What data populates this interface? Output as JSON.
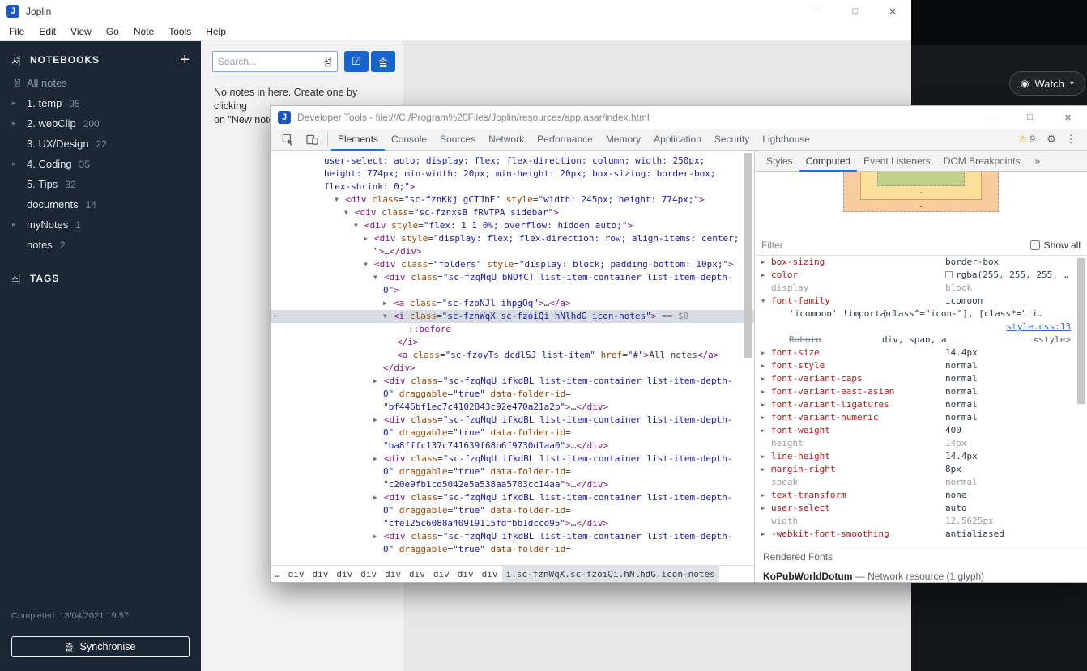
{
  "glyphs": {
    "arrow_right": "▸",
    "tree_expanded": "▼",
    "tree_collapsed": "▶",
    "minimize": "─",
    "maximize": "□",
    "close": "✕",
    "gear": "⚙",
    "kebab": "⋮",
    "warning": "⚠",
    "overflow_chevrons": "»",
    "dots": "⋯",
    "plus": "+",
    "caret_down": "▾"
  },
  "joplin": {
    "title": "Joplin",
    "app_letter": "J",
    "menu": [
      "File",
      "Edit",
      "View",
      "Go",
      "Note",
      "Tools",
      "Help"
    ],
    "sidebar": {
      "notebooks_label": "NOTEBOOKS",
      "notebooks_icon": "셔",
      "all_notes_icon": "셩",
      "all_notes_label": "All notes",
      "folders": [
        {
          "label": "1. temp",
          "count": "95",
          "arrow": true
        },
        {
          "label": "2. webClip",
          "count": "200",
          "arrow": true
        },
        {
          "label": "3. UX/Design",
          "count": "22",
          "arrow": false
        },
        {
          "label": "4. Coding",
          "count": "35",
          "arrow": true
        },
        {
          "label": "5. Tips",
          "count": "32",
          "arrow": false
        },
        {
          "label": "documents",
          "count": "14",
          "arrow": false
        },
        {
          "label": "myNotes",
          "count": "1",
          "arrow": true
        },
        {
          "label": "notes",
          "count": "2",
          "arrow": false
        }
      ],
      "tags_label": "TAGS",
      "tags_icon": "싀",
      "status": "Completed: 13/04/2021 19:57",
      "sync_label": "Synchronise",
      "sync_icon": "츨"
    },
    "notelist": {
      "search_placeholder": "Search...",
      "search_icon": "성",
      "toggle_button_icon": "☑",
      "sort_button_icon": "솔",
      "empty_lines": [
        "No notes in here. Create one by clicking",
        "on \"New note\"."
      ]
    }
  },
  "background": {
    "watch_label": "Watch",
    "watch_icon": "◉"
  },
  "devtools": {
    "title": "Developer Tools - file:///C:/Program%20Files/Joplin/resources/app.asar/index.html",
    "app_letter": "J",
    "toolbar": {
      "tabs": [
        {
          "label": "Elements",
          "active": true
        },
        {
          "label": "Console"
        },
        {
          "label": "Sources"
        },
        {
          "label": "Network"
        },
        {
          "label": "Performance"
        },
        {
          "label": "Memory"
        },
        {
          "label": "Application"
        },
        {
          "label": "Security"
        },
        {
          "label": "Lighthouse"
        }
      ],
      "warning_count": "9"
    },
    "elements": {
      "lines": [
        {
          "i": 58,
          "seg": [
            [
              "v",
              "user-select: auto; display: flex; flex-direction: column; width: 250px;"
            ]
          ]
        },
        {
          "i": 58,
          "seg": [
            [
              "v",
              "height: 774px; min-width: 20px; min-height: 20px; box-sizing: border-box;"
            ]
          ]
        },
        {
          "i": 58,
          "seg": [
            [
              "v",
              "flex-shrink: 0;\""
            ],
            [
              "t",
              ">"
            ]
          ]
        },
        {
          "i": 71,
          "a": "v",
          "seg": [
            [
              "t",
              "<div"
            ],
            [
              "a",
              " class"
            ],
            [
              "p",
              "="
            ],
            [
              "v",
              "\"sc-fznKkj gCTJhE\""
            ],
            [
              "a",
              " style"
            ],
            [
              "p",
              "="
            ],
            [
              "v",
              "\"width: 245px; height: 774px;\""
            ],
            [
              "t",
              ">"
            ]
          ]
        },
        {
          "i": 83,
          "a": "v",
          "seg": [
            [
              "t",
              "<div"
            ],
            [
              "a",
              " class"
            ],
            [
              "p",
              "="
            ],
            [
              "v",
              "\"sc-fznxsB fRVTPA sidebar\""
            ],
            [
              "t",
              ">"
            ]
          ]
        },
        {
          "i": 95,
          "a": "v",
          "seg": [
            [
              "t",
              "<div"
            ],
            [
              "a",
              " style"
            ],
            [
              "p",
              "="
            ],
            [
              "v",
              "\"flex: 1 1 0%; overflow: hidden auto;\""
            ],
            [
              "t",
              ">"
            ]
          ]
        },
        {
          "i": 107,
          "a": "r",
          "seg": [
            [
              "t",
              "<div"
            ],
            [
              "a",
              " style"
            ],
            [
              "p",
              "="
            ],
            [
              "v",
              "\"display: flex; flex-direction: row; align-items: center;"
            ]
          ]
        },
        {
          "i": 119,
          "seg": [
            [
              "v",
              "\""
            ],
            [
              "t",
              ">"
            ],
            [
              "p",
              "…"
            ],
            [
              "t",
              "</div>"
            ]
          ]
        },
        {
          "i": 107,
          "a": "v",
          "seg": [
            [
              "t",
              "<div"
            ],
            [
              "a",
              " class"
            ],
            [
              "p",
              "="
            ],
            [
              "v",
              "\"folders\""
            ],
            [
              "a",
              " style"
            ],
            [
              "p",
              "="
            ],
            [
              "v",
              "\"display: block; padding-bottom: 10px;\""
            ],
            [
              "t",
              ">"
            ]
          ]
        },
        {
          "i": 119,
          "a": "v",
          "seg": [
            [
              "t",
              "<div"
            ],
            [
              "a",
              " class"
            ],
            [
              "p",
              "="
            ],
            [
              "v",
              "\"sc-fzqNqU bNOfCT list-item-container list-item-depth-"
            ]
          ]
        },
        {
          "i": 131,
          "seg": [
            [
              "v",
              "0\""
            ],
            [
              "t",
              ">"
            ]
          ]
        },
        {
          "i": 131,
          "a": "r",
          "seg": [
            [
              "t",
              "<a"
            ],
            [
              "a",
              " class"
            ],
            [
              "p",
              "="
            ],
            [
              "v",
              "\"sc-fzoNJl ihpgOq\""
            ],
            [
              "t",
              ">"
            ],
            [
              "p",
              "…"
            ],
            [
              "t",
              "</a>"
            ]
          ]
        },
        {
          "i": 131,
          "a": "v",
          "sel": true,
          "seg": [
            [
              "t",
              "<i"
            ],
            [
              "a",
              " class"
            ],
            [
              "p",
              "="
            ],
            [
              "v",
              "\"sc-fznWqX sc-fzoiQi hNlhdG icon-notes\""
            ],
            [
              "t",
              ">"
            ],
            [
              "g",
              " == $0"
            ]
          ]
        },
        {
          "i": 162,
          "seg": [
            [
              "t",
              "::before"
            ]
          ]
        },
        {
          "i": 148,
          "seg": [
            [
              "t",
              "</i>"
            ]
          ]
        },
        {
          "i": 148,
          "seg": [
            [
              "t",
              "<a"
            ],
            [
              "a",
              " class"
            ],
            [
              "p",
              "="
            ],
            [
              "v",
              "\"sc-fzoyTs dcdlSJ list-item\""
            ],
            [
              "a",
              " href"
            ],
            [
              "p",
              "="
            ],
            [
              "v",
              "\""
            ],
            [
              "l",
              "#"
            ],
            [
              "v",
              "\""
            ],
            [
              "t",
              ">"
            ],
            [
              "p",
              "All notes"
            ],
            [
              "t",
              "</a>"
            ]
          ]
        },
        {
          "i": 131,
          "seg": [
            [
              "t",
              "</div>"
            ]
          ]
        },
        {
          "i": 119,
          "a": "r",
          "seg": [
            [
              "t",
              "<div"
            ],
            [
              "a",
              " class"
            ],
            [
              "p",
              "="
            ],
            [
              "v",
              "\"sc-fzqNqU ifkdBL list-item-container list-item-depth-"
            ]
          ]
        },
        {
          "i": 131,
          "seg": [
            [
              "v",
              "0\""
            ],
            [
              "a",
              " draggable"
            ],
            [
              "p",
              "="
            ],
            [
              "v",
              "\"true\""
            ],
            [
              "a",
              " data-folder-id"
            ],
            [
              "p",
              "="
            ]
          ]
        },
        {
          "i": 131,
          "seg": [
            [
              "v",
              "\"bf446bf1ec7c4102843c92e470a21a2b\""
            ],
            [
              "t",
              ">"
            ],
            [
              "p",
              "…"
            ],
            [
              "t",
              "</div>"
            ]
          ]
        },
        {
          "i": 119,
          "a": "r",
          "seg": [
            [
              "t",
              "<div"
            ],
            [
              "a",
              " class"
            ],
            [
              "p",
              "="
            ],
            [
              "v",
              "\"sc-fzqNqU ifkdBL list-item-container list-item-depth-"
            ]
          ]
        },
        {
          "i": 131,
          "seg": [
            [
              "v",
              "0\""
            ],
            [
              "a",
              " draggable"
            ],
            [
              "p",
              "="
            ],
            [
              "v",
              "\"true\""
            ],
            [
              "a",
              " data-folder-id"
            ],
            [
              "p",
              "="
            ]
          ]
        },
        {
          "i": 131,
          "seg": [
            [
              "v",
              "\"ba8fffc137c741639f68b6f9730d1aa0\""
            ],
            [
              "t",
              ">"
            ],
            [
              "p",
              "…"
            ],
            [
              "t",
              "</div>"
            ]
          ]
        },
        {
          "i": 119,
          "a": "r",
          "seg": [
            [
              "t",
              "<div"
            ],
            [
              "a",
              " class"
            ],
            [
              "p",
              "="
            ],
            [
              "v",
              "\"sc-fzqNqU ifkdBL list-item-container list-item-depth-"
            ]
          ]
        },
        {
          "i": 131,
          "seg": [
            [
              "v",
              "0\""
            ],
            [
              "a",
              " draggable"
            ],
            [
              "p",
              "="
            ],
            [
              "v",
              "\"true\""
            ],
            [
              "a",
              " data-folder-id"
            ],
            [
              "p",
              "="
            ]
          ]
        },
        {
          "i": 131,
          "seg": [
            [
              "v",
              "\"c20e9fb1cd5042e5a538aa5703cc14aa\""
            ],
            [
              "t",
              ">"
            ],
            [
              "p",
              "…"
            ],
            [
              "t",
              "</div>"
            ]
          ]
        },
        {
          "i": 119,
          "a": "r",
          "seg": [
            [
              "t",
              "<div"
            ],
            [
              "a",
              " class"
            ],
            [
              "p",
              "="
            ],
            [
              "v",
              "\"sc-fzqNqU ifkdBL list-item-container list-item-depth-"
            ]
          ]
        },
        {
          "i": 131,
          "seg": [
            [
              "v",
              "0\""
            ],
            [
              "a",
              " draggable"
            ],
            [
              "p",
              "="
            ],
            [
              "v",
              "\"true\""
            ],
            [
              "a",
              " data-folder-id"
            ],
            [
              "p",
              "="
            ]
          ]
        },
        {
          "i": 131,
          "seg": [
            [
              "v",
              "\"cfe125c6088a40919115fdfbb1dccd95\""
            ],
            [
              "t",
              ">"
            ],
            [
              "p",
              "…"
            ],
            [
              "t",
              "</div>"
            ]
          ]
        },
        {
          "i": 119,
          "a": "r",
          "seg": [
            [
              "t",
              "<div"
            ],
            [
              "a",
              " class"
            ],
            [
              "p",
              "="
            ],
            [
              "v",
              "\"sc-fzqNqU ifkdBL list-item-container list-item-depth-"
            ]
          ]
        },
        {
          "i": 131,
          "seg": [
            [
              "v",
              "0\""
            ],
            [
              "a",
              " draggable"
            ],
            [
              "p",
              "="
            ],
            [
              "v",
              "\"true\""
            ],
            [
              "a",
              " data-folder-id"
            ],
            [
              "p",
              "="
            ]
          ]
        }
      ],
      "breadcrumbs": [
        {
          "label": "…"
        },
        {
          "label": "div"
        },
        {
          "label": "div"
        },
        {
          "label": "div"
        },
        {
          "label": "div"
        },
        {
          "label": "div"
        },
        {
          "label": "div"
        },
        {
          "label": "div"
        },
        {
          "label": "div"
        },
        {
          "label": "div"
        },
        {
          "label": "i.sc-fznWqX.sc-fzoiQi.hNlhdG.icon-notes",
          "selected": true
        }
      ]
    },
    "sidebar": {
      "tabs": [
        {
          "label": "Styles"
        },
        {
          "label": "Computed",
          "active": true
        },
        {
          "label": "Event Listeners"
        },
        {
          "label": "DOM Breakpoints"
        }
      ],
      "box_model": {
        "dash1": "-",
        "dash2": "-"
      },
      "filter_placeholder": "Filter",
      "show_all_label": "Show all",
      "properties": [
        {
          "name": "box-sizing",
          "value": "border-box"
        },
        {
          "name": "color",
          "value": "rgba(255, 255, 255, …",
          "swatch": "#ffffff"
        },
        {
          "name": "display",
          "value": "block",
          "gray": true
        },
        {
          "name": "font-family",
          "value": "icomoon",
          "expanded": true
        },
        {
          "name": "font-size",
          "value": "14.4px"
        },
        {
          "name": "font-style",
          "value": "normal"
        },
        {
          "name": "font-variant-caps",
          "value": "normal"
        },
        {
          "name": "font-variant-east-asian",
          "value": "normal"
        },
        {
          "name": "font-variant-ligatures",
          "value": "normal"
        },
        {
          "name": "font-variant-numeric",
          "value": "normal"
        },
        {
          "name": "font-weight",
          "value": "400"
        },
        {
          "name": "height",
          "value": "14px",
          "gray": true
        },
        {
          "name": "line-height",
          "value": "14.4px"
        },
        {
          "name": "margin-right",
          "value": "8px"
        },
        {
          "name": "speak",
          "value": "normal",
          "gray": true
        },
        {
          "name": "text-transform",
          "value": "none"
        },
        {
          "name": "user-select",
          "value": "auto"
        },
        {
          "name": "width",
          "value": "12.5625px",
          "gray": true
        },
        {
          "name": "-webkit-font-smoothing",
          "value": "antialiased"
        }
      ],
      "font_trace": [
        {
          "left": "'icomoon' !important",
          "mid": "[class^=\"icon-\"], [class*=\" i…"
        },
        {
          "link": "style.css:13"
        },
        {
          "left_strike": "Roboto",
          "mid": "div, span, a",
          "right": "<style>"
        }
      ],
      "rendered_fonts": {
        "header": "Rendered Fonts",
        "name": "KoPubWorldDotum",
        "detail": "— Network resource (1 glyph)"
      }
    }
  }
}
